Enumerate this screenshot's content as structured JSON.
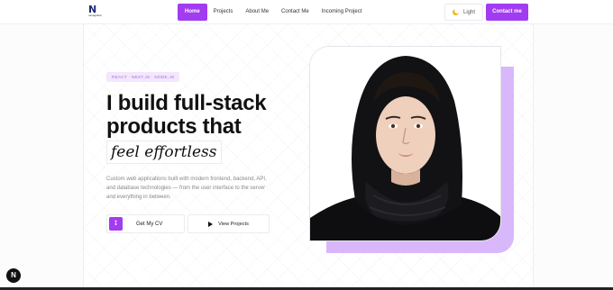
{
  "nav": {
    "logo_text": "N",
    "logo_sub": "navaglobal",
    "links": [
      {
        "label": "Home",
        "active": true
      },
      {
        "label": "Projects",
        "active": false
      },
      {
        "label": "About Me",
        "active": false
      },
      {
        "label": "Contact Me",
        "active": false
      },
      {
        "label": "Incoming Project",
        "active": false
      }
    ],
    "theme_label": "Light",
    "theme_icon": "moon-icon",
    "contact_button": "Contact me"
  },
  "hero": {
    "badge": "REACT · NEXT.JS · NODE.JS",
    "heading_line1": "I build full-stack",
    "heading_line2": "products that",
    "heading_highlight": "feel effortless",
    "description": "Custom web applications built with modern frontend, backend, API, and database technologies — from the user interface to the server and everything in between.",
    "cv_button": "Get My CV",
    "cv_icon": "download-icon",
    "projects_button": "View Projects",
    "projects_icon": "play-icon"
  },
  "portrait": {
    "subject": "woman in black hijab"
  },
  "dev_badge": "N",
  "colors": {
    "accent": "#a23cf0",
    "accent_light": "#d9b7fb"
  }
}
